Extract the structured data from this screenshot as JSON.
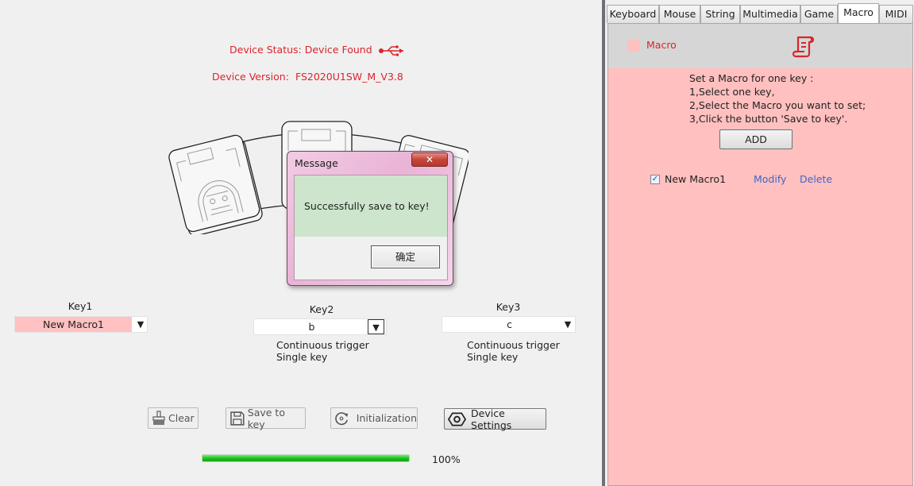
{
  "device": {
    "status_label": "Device Status: Device Found",
    "version_label": "Device Version:",
    "version_value": "FS2020U1SW_M_V3.8",
    "accent_color": "#d9252b"
  },
  "keys": [
    {
      "label": "Key1",
      "value": "New Macro1",
      "desc1": "",
      "desc2": ""
    },
    {
      "label": "Key2",
      "value": "b",
      "desc1": "Continuous trigger",
      "desc2": "Single key"
    },
    {
      "label": "Key3",
      "value": "c",
      "desc1": "Continuous trigger",
      "desc2": "Single key"
    }
  ],
  "toolbar": {
    "clear_label": "Clear",
    "save_label": "Save to key",
    "init_label": "Initialization",
    "settings_label": "Device Settings"
  },
  "progress": {
    "value_percent": 100,
    "text": "100%"
  },
  "dialog": {
    "title": "Message",
    "close_glyph": "✕",
    "message": "Successfully save to key!",
    "ok_label": "确定"
  },
  "tabs": [
    {
      "label": "Keyboard"
    },
    {
      "label": "Mouse"
    },
    {
      "label": "String"
    },
    {
      "label": "Multimedia"
    },
    {
      "label": "Game"
    },
    {
      "label": "Macro",
      "active": true
    },
    {
      "label": "MIDI"
    }
  ],
  "macro_panel": {
    "title": "Macro",
    "instructions": "Set a Macro for one key :\n1,Select one key,\n2,Select the Macro you want to set;\n3,Click the button 'Save to key'.",
    "add_label": "ADD",
    "items": [
      {
        "name": "New Macro1",
        "checked": true,
        "check_glyph": "✓",
        "modify_label": "Modify",
        "delete_label": "Delete"
      }
    ]
  },
  "icons": {
    "combo_arrow": "▼"
  }
}
